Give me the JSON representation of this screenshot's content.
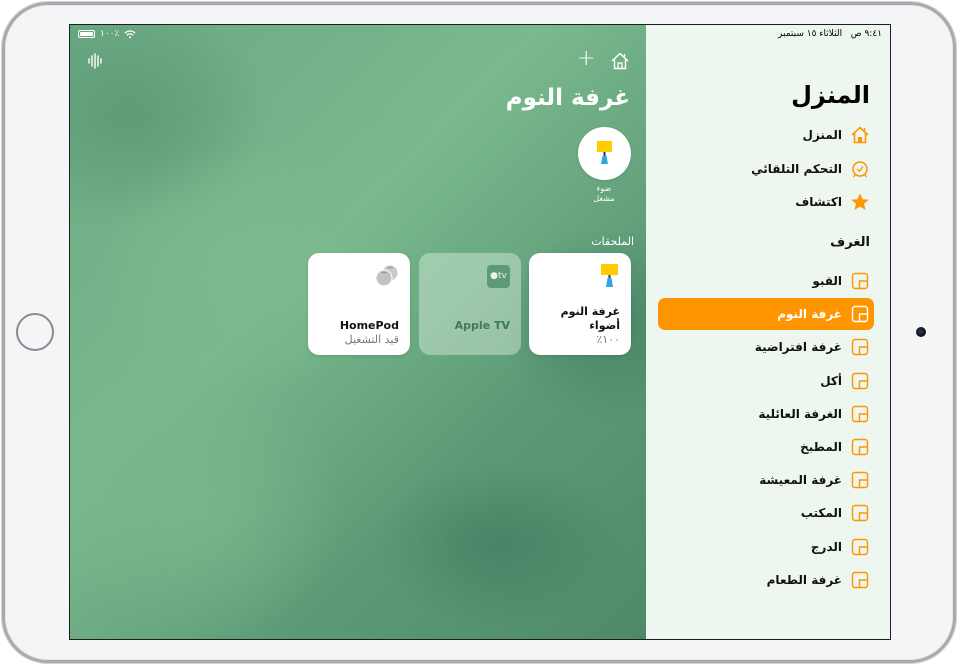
{
  "status_bar": {
    "time": "٩:٤١ ص",
    "date": "الثلاثاء ١٥ سبتمبر",
    "battery": "١٠٠٪"
  },
  "main": {
    "room_title": "غرفة النوم",
    "scene": {
      "label_line1": "ضوء",
      "label_line2": "مشغل"
    },
    "accessories_header": "الملحقات",
    "tiles": [
      {
        "name_line1": "غرفة النوم",
        "name_line2": "أضواء",
        "status": "١٠٠٪",
        "state": "on",
        "icon": "lamp-icon"
      },
      {
        "name_line1": "Apple TV",
        "status": "",
        "state": "off",
        "icon": "apple-tv-icon",
        "badge": "tv"
      },
      {
        "name_line1": "HomePod",
        "status": "قيد التشغيل",
        "state": "on",
        "icon": "homepod-icon"
      }
    ]
  },
  "sidebar": {
    "title": "المنزل",
    "nav": [
      {
        "label": "المنزل",
        "icon": "home-icon"
      },
      {
        "label": "التحكم التلقائي",
        "icon": "automation-clock-icon"
      },
      {
        "label": "اكتشاف",
        "icon": "star-icon"
      }
    ],
    "rooms_header": "الغرف",
    "rooms": [
      {
        "label": "القبو",
        "active": false
      },
      {
        "label": "غرفة النوم",
        "active": true
      },
      {
        "label": "غرفة افتراضية",
        "active": false
      },
      {
        "label": "أكل",
        "active": false
      },
      {
        "label": "الغرفة العائلية",
        "active": false
      },
      {
        "label": "المطبخ",
        "active": false
      },
      {
        "label": "غرفة المعيشة",
        "active": false
      },
      {
        "label": "المكتب",
        "active": false
      },
      {
        "label": "الدرج",
        "active": false
      },
      {
        "label": "غرفة الطعام",
        "active": false
      }
    ]
  },
  "colors": {
    "accent": "#ff9500",
    "sidebar_bg": "#edf6ef",
    "wallpaper_green": "#6aa883"
  }
}
